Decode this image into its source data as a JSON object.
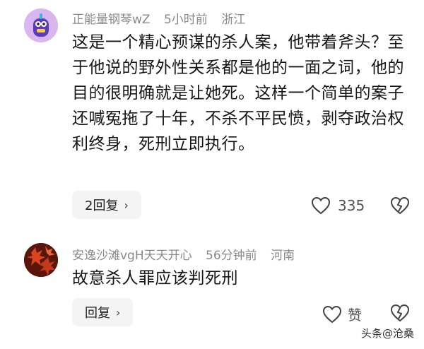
{
  "comments": [
    {
      "author": "正能量钢琴wZ",
      "time": "5小时前",
      "location": "浙江",
      "text": "这是一个精心预谋的杀人案，他带着斧头？至于他说的野外性关系都是他的一面之词，他的目的很明确就是让她死。这样一个简单的案子还喊冤拖了十年，不杀不平民愤，剥夺政治权利终身，死刑立即执行。",
      "reply_label": "2回复",
      "likes": "335",
      "avatar_icon": "cartoon-character-avatar"
    },
    {
      "author": "安逸沙滩vgH天天开心",
      "time": "56分钟前",
      "location": "河南",
      "text": "故意杀人罪应该判死刑",
      "reply_label": "回复",
      "likes": "赞",
      "avatar_icon": "red-leaves-avatar"
    }
  ],
  "watermark": "头条@沧桑",
  "colors": {
    "meta_text": "#8a8a8a",
    "reply_bg": "#f4f4f4",
    "avatar1_bg": "#d9b6ef",
    "avatar2_leaves": "#c23a1a"
  }
}
